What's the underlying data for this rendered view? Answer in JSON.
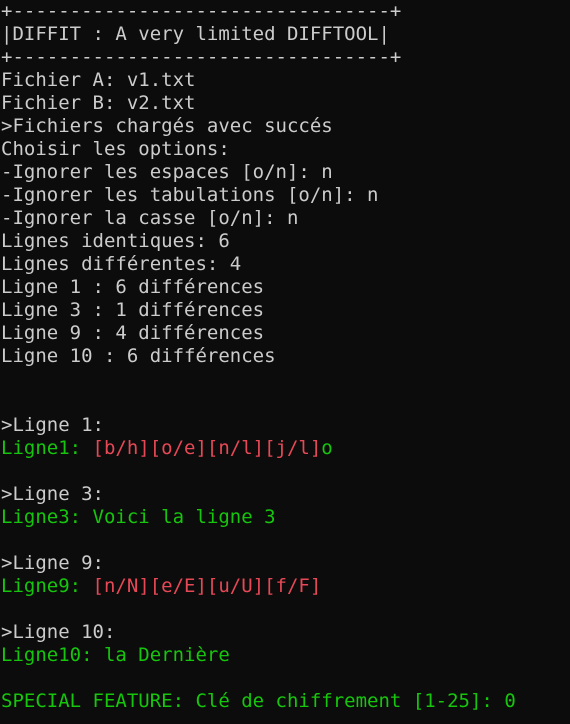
{
  "colors": {
    "background": "#0c0c0c",
    "text": "#cccccc",
    "green": "#16c60c",
    "red": "#e74856"
  },
  "banner": {
    "top": "+---------------------------------+",
    "title": "|DIFFIT : A very limited DIFFTOOL|",
    "bottom": "+---------------------------------+"
  },
  "files": {
    "a": "Fichier A: v1.txt",
    "b": "Fichier B: v2.txt",
    "loaded": ">Fichiers chargés avec succés"
  },
  "options": {
    "heading": "Choisir les options:",
    "spaces": "-Ignorer les espaces [o/n]: n",
    "tabs": "-Ignorer les tabulations [o/n]: n",
    "case": "-Ignorer la casse [o/n]: n"
  },
  "stats": {
    "identical": "Lignes identiques: 6",
    "different": "Lignes différentes: 4"
  },
  "summary": [
    "Ligne 1 : 6 différences",
    "Ligne 3 : 1 différences",
    "Ligne 9 : 4 différences",
    "Ligne 10 : 6 différences"
  ],
  "details": [
    {
      "header": ">Ligne 1:",
      "prefix": "Ligne1: ",
      "diff": "[b/h][o/e][n/l][j/l]",
      "tail": "o"
    },
    {
      "header": ">Ligne 3:",
      "prefix": "Ligne3: ",
      "diff": "",
      "tail": "Voici la ligne 3"
    },
    {
      "header": ">Ligne 9:",
      "prefix": "Ligne9: ",
      "diff": "[n/N][e/E][u/U][f/F]",
      "tail": ""
    },
    {
      "header": ">Ligne 10:",
      "prefix": "Ligne10: ",
      "diff": "",
      "tail": "la Dernière"
    }
  ],
  "special": "SPECIAL FEATURE: Clé de chiffrement [1-25]: 0"
}
